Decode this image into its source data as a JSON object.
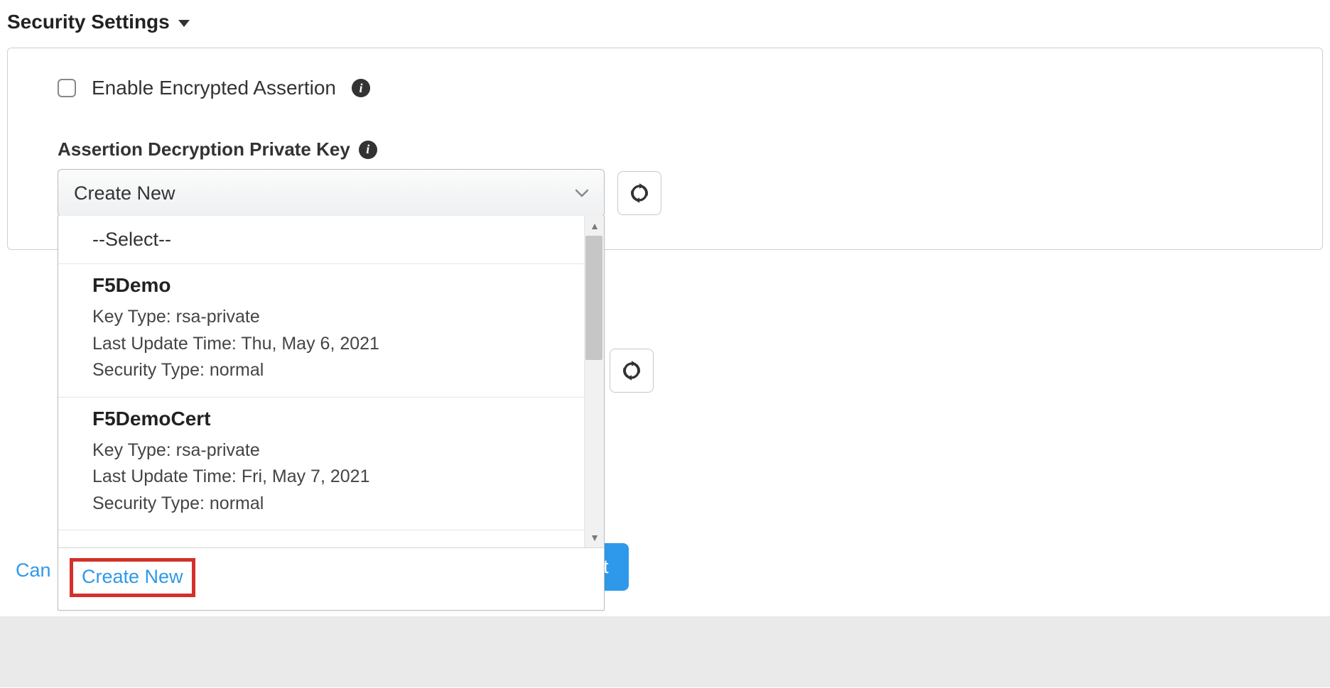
{
  "section": {
    "title": "Security Settings"
  },
  "checkbox": {
    "label": "Enable Encrypted Assertion"
  },
  "field": {
    "label": "Assertion Decryption Private Key",
    "selected": "Create New",
    "placeholder": "--Select--",
    "options": [
      {
        "name": "F5Demo",
        "key_type_label": "Key Type:",
        "key_type": "rsa-private",
        "last_update_label": "Last Update Time:",
        "last_update": "Thu, May 6, 2021",
        "security_type_label": "Security Type:",
        "security_type": "normal"
      },
      {
        "name": "F5DemoCert",
        "key_type_label": "Key Type:",
        "key_type": "rsa-private",
        "last_update_label": "Last Update Time:",
        "last_update": "Fri, May 7, 2021",
        "security_type_label": "Security Type:",
        "security_type": "normal"
      }
    ],
    "create_new": "Create New"
  },
  "footer": {
    "cancel": "Can",
    "next": "t"
  }
}
